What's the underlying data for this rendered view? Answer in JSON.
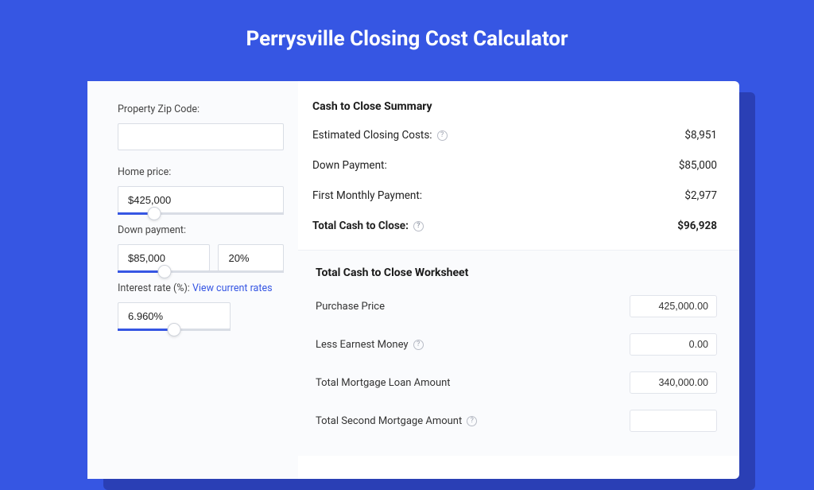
{
  "page": {
    "title": "Perrysville Closing Cost Calculator"
  },
  "left": {
    "zip_label": "Property Zip Code:",
    "zip_value": "",
    "home_price_label": "Home price:",
    "home_price_value": "$425,000",
    "down_payment_label": "Down payment:",
    "down_payment_value": "$85,000",
    "down_payment_pct": "20%",
    "interest_label": "Interest rate (%): ",
    "interest_link": "View current rates",
    "interest_value": "6.960%"
  },
  "summary": {
    "title": "Cash to Close Summary",
    "rows": [
      {
        "label": "Estimated Closing Costs:",
        "help": true,
        "value": "$8,951"
      },
      {
        "label": "Down Payment:",
        "help": false,
        "value": "$85,000"
      },
      {
        "label": "First Monthly Payment:",
        "help": false,
        "value": "$2,977"
      }
    ],
    "total_label": "Total Cash to Close:",
    "total_value": "$96,928"
  },
  "worksheet": {
    "title": "Total Cash to Close Worksheet",
    "rows": [
      {
        "label": "Purchase Price",
        "help": false,
        "value": "425,000.00"
      },
      {
        "label": "Less Earnest Money",
        "help": true,
        "value": "0.00"
      },
      {
        "label": "Total Mortgage Loan Amount",
        "help": false,
        "value": "340,000.00"
      },
      {
        "label": "Total Second Mortgage Amount",
        "help": true,
        "value": ""
      }
    ]
  },
  "sliders": {
    "home_price_pct": "22%",
    "down_payment_pct": "28%",
    "interest_pct": "50%"
  }
}
